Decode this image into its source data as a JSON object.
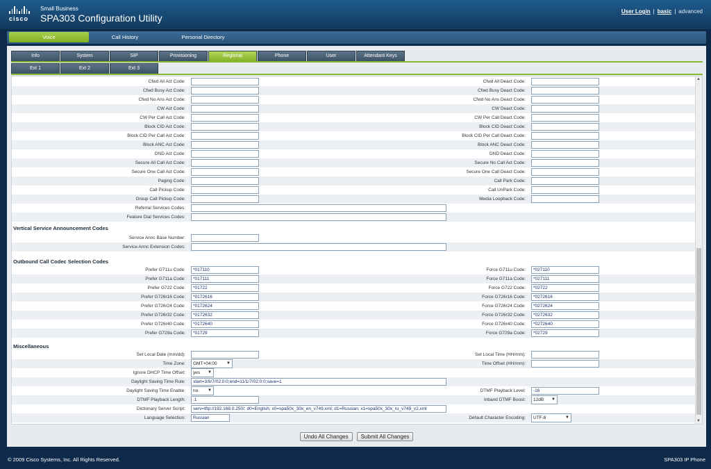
{
  "header": {
    "company": "cisco",
    "brand_small": "Small Business",
    "brand_title": "SPA303 Configuration Utility",
    "user_login": "User Login",
    "basic": "basic",
    "advanced": "advanced"
  },
  "nav": [
    "Voice",
    "Call History",
    "Personal Directory"
  ],
  "tabs": [
    "Info",
    "System",
    "SIP",
    "Provisioning",
    "Regional",
    "Phone",
    "User",
    "Attendant Keys"
  ],
  "subtabs": [
    "Ext 1",
    "Ext 2",
    "Ext 3"
  ],
  "star_codes": [
    {
      "l": "Cfwd All Act Code:",
      "lv": "",
      "r": "Cfwd All Deact Code:",
      "rv": ""
    },
    {
      "l": "Cfwd Busy Act Code:",
      "lv": "",
      "r": "Cfwd Busy Deact Code:",
      "rv": ""
    },
    {
      "l": "Cfwd No Ans Act Code:",
      "lv": "",
      "r": "Cfwd No Ans Deact Code:",
      "rv": ""
    },
    {
      "l": "CW Act Code:",
      "lv": "",
      "r": "CW Deact Code:",
      "rv": ""
    },
    {
      "l": "CW Per Call Act Code:",
      "lv": "",
      "r": "CW Per Call Deact Code:",
      "rv": ""
    },
    {
      "l": "Block CID Act Code:",
      "lv": "",
      "r": "Block CID Deact Code:",
      "rv": ""
    },
    {
      "l": "Block CID Per Call Act Code:",
      "lv": "",
      "r": "Block CID Per Call Deact Code:",
      "rv": ""
    },
    {
      "l": "Block ANC Act Code:",
      "lv": "",
      "r": "Block ANC Deact Code:",
      "rv": ""
    },
    {
      "l": "DND Act Code:",
      "lv": "",
      "r": "DND Deact Code:",
      "rv": ""
    },
    {
      "l": "Secure All Call Act Code:",
      "lv": "",
      "r": "Secure No Call Act Code:",
      "rv": ""
    },
    {
      "l": "Secure One Call Act Code:",
      "lv": "",
      "r": "Secure One Call Deact Code:",
      "rv": ""
    },
    {
      "l": "Paging Code:",
      "lv": "",
      "r": "Call Park Code:",
      "rv": ""
    },
    {
      "l": "Call Pickup Code:",
      "lv": "",
      "r": "Call UnPark Code:",
      "rv": ""
    },
    {
      "l": "Group Call Pickup Code:",
      "lv": "",
      "r": "Media Loopback Code:",
      "rv": ""
    }
  ],
  "wide_codes": [
    {
      "l": "Referral Services Codes:",
      "v": ""
    },
    {
      "l": "Feature Dial Services Codes:",
      "v": ""
    }
  ],
  "vsa": {
    "title": "Vertical Service Announcement Codes",
    "base_label": "Service Annc Base Number:",
    "base_value": "",
    "ext_label": "Service Annc Extension Codes:",
    "ext_value": ""
  },
  "codec": {
    "title": "Outbound Call Codec Selection Codes",
    "rows": [
      {
        "l": "Prefer G711u Code:",
        "lv": "*017110",
        "r": "Force G711u Code:",
        "rv": "*027110"
      },
      {
        "l": "Prefer G711a Code:",
        "lv": "*017111",
        "r": "Force G711a Code:",
        "rv": "*027111"
      },
      {
        "l": "Prefer G722 Code:",
        "lv": "*01722",
        "r": "Force G722 Code:",
        "rv": "*02722"
      },
      {
        "l": "Prefer G726r16 Code:",
        "lv": "*0172616",
        "r": "Force G726r16 Code:",
        "rv": "*0272616"
      },
      {
        "l": "Prefer G726r24 Code:",
        "lv": "*0172624",
        "r": "Force G726r24 Code:",
        "rv": "*0272624"
      },
      {
        "l": "Prefer G726r32 Code:",
        "lv": "*0172632",
        "r": "Force G726r32 Code:",
        "rv": "*0272632"
      },
      {
        "l": "Prefer G726r40 Code:",
        "lv": "*0172640",
        "r": "Force G726r40 Code:",
        "rv": "*0272640"
      },
      {
        "l": "Prefer G729a Code:",
        "lv": "*01729",
        "r": "Force G729a Code:",
        "rv": "*02729"
      }
    ]
  },
  "misc": {
    "title": "Miscellaneous",
    "local_date_label": "Set Local Date (mm/dd):",
    "local_date": "",
    "local_time_label": "Set Local Time (HH/mm):",
    "local_time": "",
    "tz_label": "Time Zone:",
    "tz_value": "GMT+04:00",
    "offset_label": "Time Offset (HH/mm):",
    "offset_value": "",
    "ignore_dhcp_label": "Ignore DHCP Time Offset:",
    "ignore_dhcp_value": "yes",
    "dst_rule_label": "Daylight Saving Time Rule:",
    "dst_rule_value": "start=3/8/7/02:0:0;end=11/1/7/02:0:0;save=1",
    "dst_enable_label": "Daylight Saving Time Enable:",
    "dst_enable_value": "no",
    "dtmf_level_label": "DTMF Playback Level:",
    "dtmf_level_value": "-16",
    "dtmf_length_label": "DTMF Playback Length:",
    "dtmf_length_value": ".1",
    "inband_boost_label": "Inband DTMF Boost:",
    "inband_boost_value": "12dB",
    "dict_label": "Dictionary Server Script:",
    "dict_value": "serv=tftp://192.168.0.250/; d0=English; x0=spa50x_30x_en_v749.xml; d1=Russian; x1=spa50x_30x_ru_v749_v2.xml",
    "lang_label": "Language Selection:",
    "lang_value": "Russian",
    "enc_label": "Default Character Encoding:",
    "enc_value": "UTF-8"
  },
  "buttons": {
    "undo": "Undo All Changes",
    "submit": "Submit All Changes"
  },
  "footer": {
    "copyright": "© 2009 Cisco Systems, Inc. All Rights Reserved.",
    "model": "SPA303 IP Phone"
  },
  "icons": {
    "scroll_up": "arrow-up-icon",
    "scroll_down": "arrow-down-icon",
    "dropdown": "chevron-down-icon"
  }
}
